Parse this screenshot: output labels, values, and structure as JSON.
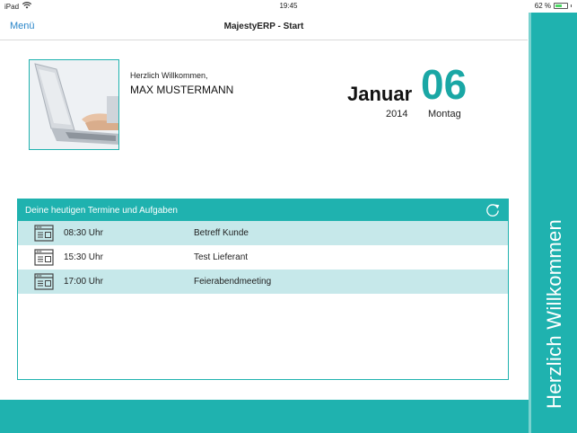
{
  "status_bar": {
    "device": "iPad",
    "time": "19:45",
    "battery": "62 %",
    "battery_level": 0.62
  },
  "nav": {
    "menu_label": "Menü",
    "title": "MajestyERP - Start"
  },
  "welcome": {
    "greeting": "Herzlich Willkommen,",
    "user_name": "MAX MUSTERMANN"
  },
  "date": {
    "month": "Januar",
    "day": "06",
    "year": "2014",
    "weekday": "Montag"
  },
  "appointments": {
    "title": "Deine heutigen Termine und Aufgaben",
    "rows": [
      {
        "time": "08:30 Uhr",
        "subject": "Betreff Kunde"
      },
      {
        "time": "15:30 Uhr",
        "subject": "Test Lieferant"
      },
      {
        "time": "17:00 Uhr",
        "subject": "Feierabendmeeting"
      }
    ]
  },
  "side_panel": {
    "label": "Herzlich Willkommen"
  },
  "colors": {
    "accent": "#1fb2af",
    "accent_dark": "#1aa7a5",
    "row_highlight": "#c6e8ea",
    "link": "#2a86c9"
  },
  "icons": {
    "wifi": "wifi-icon",
    "battery": "battery-icon",
    "refresh": "refresh-icon",
    "appointment": "calendar-window-icon"
  }
}
